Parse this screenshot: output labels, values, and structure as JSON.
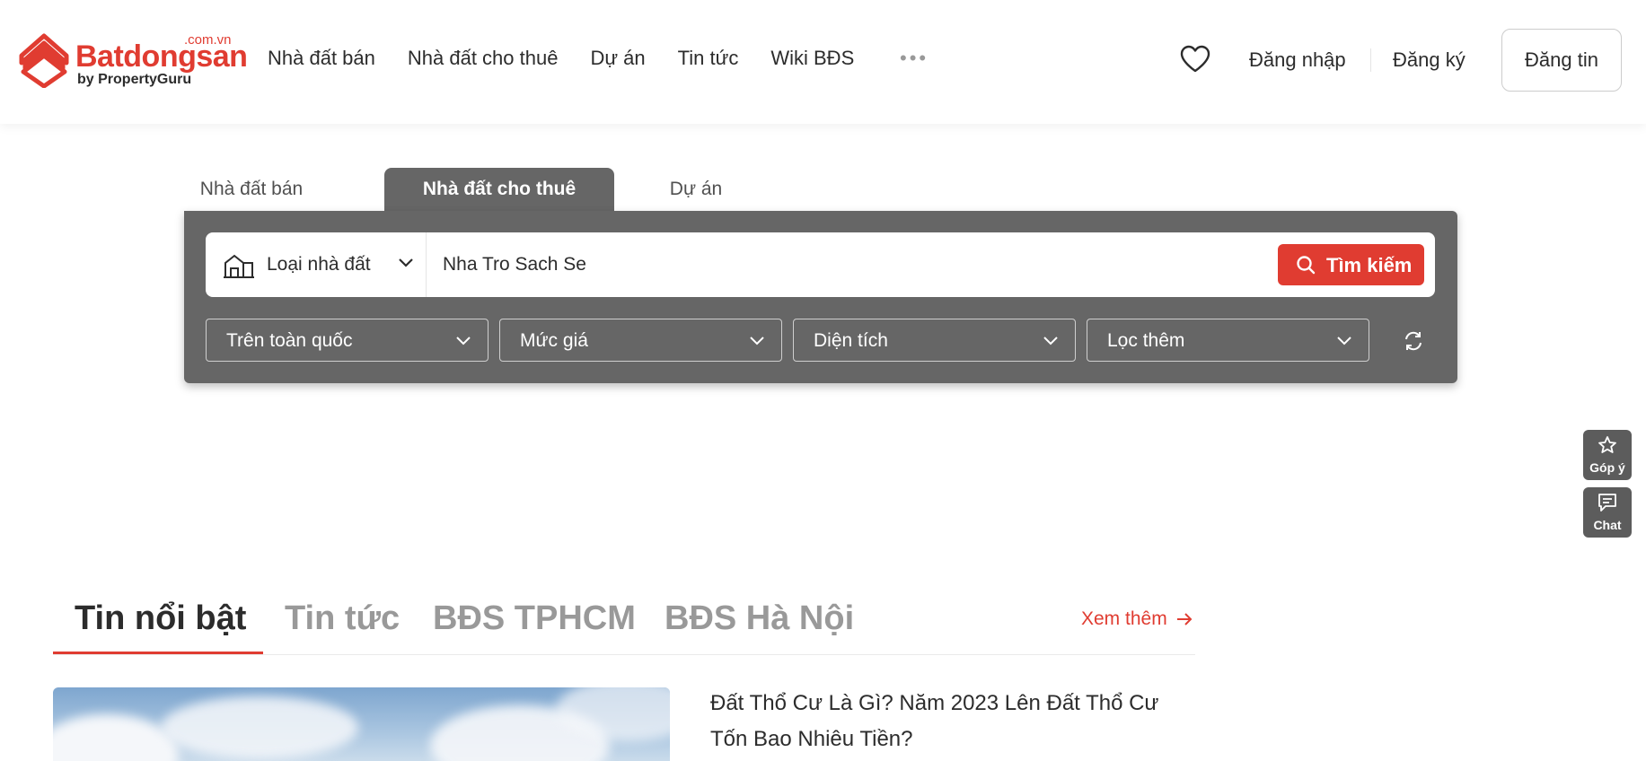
{
  "header": {
    "logo": {
      "domain": ".com.vn",
      "name": "Batdongsan",
      "by": "by PropertyGuru",
      "icon": "house-logo-icon"
    },
    "nav": [
      {
        "label": "Nhà đất bán"
      },
      {
        "label": "Nhà đất cho thuê"
      },
      {
        "label": "Dự án"
      },
      {
        "label": "Tin tức"
      },
      {
        "label": "Wiki BĐS"
      }
    ],
    "more_label": "•••",
    "login": "Đăng nhập",
    "register": "Đăng ký",
    "post_button": "Đăng tin"
  },
  "search": {
    "tabs": [
      {
        "label": "Nhà đất bán",
        "active": false
      },
      {
        "label": "Nhà đất cho thuê",
        "active": true
      },
      {
        "label": "Dự án",
        "active": false
      }
    ],
    "type_label": "Loại nhà đất",
    "query": "Nha Tro Sach Se",
    "button_label": "Tìm kiếm",
    "filters": [
      {
        "label": "Trên toàn quốc"
      },
      {
        "label": "Mức giá"
      },
      {
        "label": "Diện tích"
      },
      {
        "label": "Lọc thêm"
      }
    ]
  },
  "side": {
    "feedback_label": "Góp ý",
    "chat_label": "Chat"
  },
  "news": {
    "tabs": [
      {
        "label": "Tin nổi bật",
        "active": true
      },
      {
        "label": "Tin tức",
        "active": false
      },
      {
        "label": "BĐS TPHCM",
        "active": false
      },
      {
        "label": "BĐS Hà Nội",
        "active": false
      }
    ],
    "see_more": "Xem thêm",
    "featured_title": "Đất Thổ Cư Là Gì? Năm 2023 Lên Đất Thổ Cư Tốn Bao Nhiêu Tiền?"
  },
  "colors": {
    "brand": "#e03c31",
    "panel": "#666666",
    "text": "#2c2c2c"
  }
}
